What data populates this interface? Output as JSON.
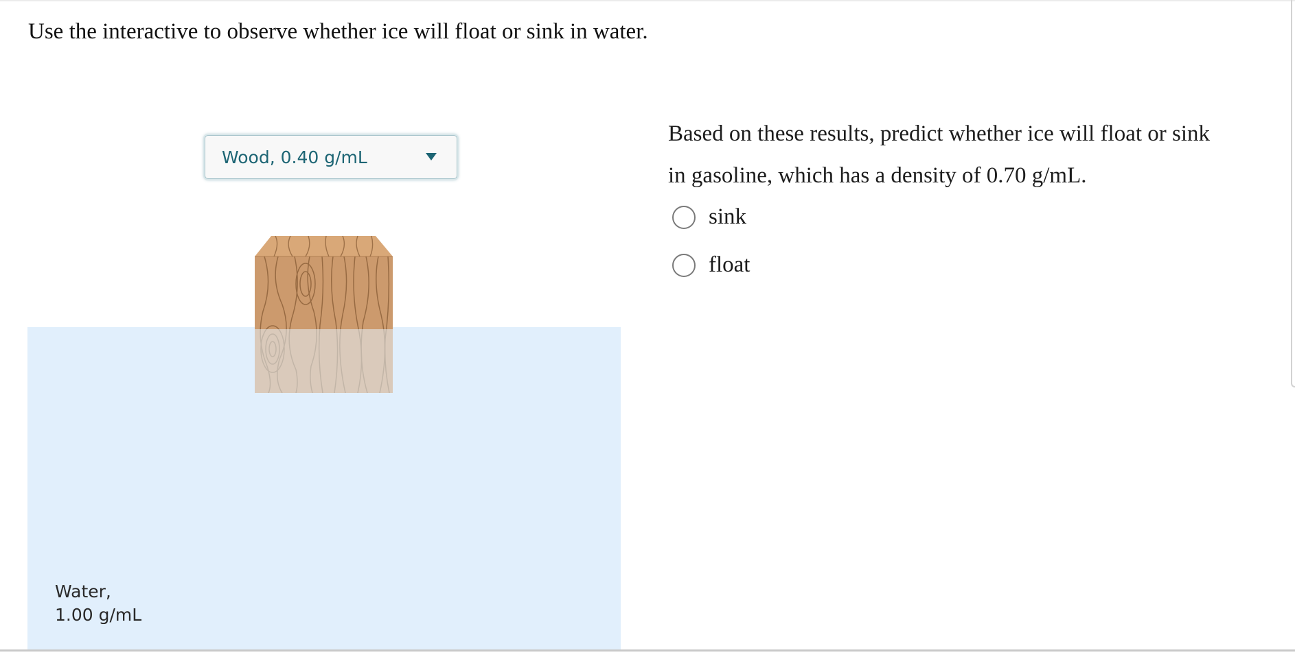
{
  "instructions": "Use the interactive to observe whether ice will float or sink in water.",
  "interactive": {
    "material_select": {
      "selected": "Wood, 0.40 g/mL",
      "accent_color": "#1d6574"
    },
    "liquid": {
      "name_line": "Water,",
      "density_line": "1.00 g/mL",
      "color": "#e1effc"
    },
    "object": {
      "material": "wood",
      "icon": "wood-block",
      "submerged_fraction": 0.4
    }
  },
  "question": {
    "prompt": "Based on these results, predict whether ice will float or sink in gasoline, which has a density of 0.70 g/mL.",
    "options": [
      {
        "label": "sink",
        "selected": false
      },
      {
        "label": "float",
        "selected": false
      }
    ]
  }
}
